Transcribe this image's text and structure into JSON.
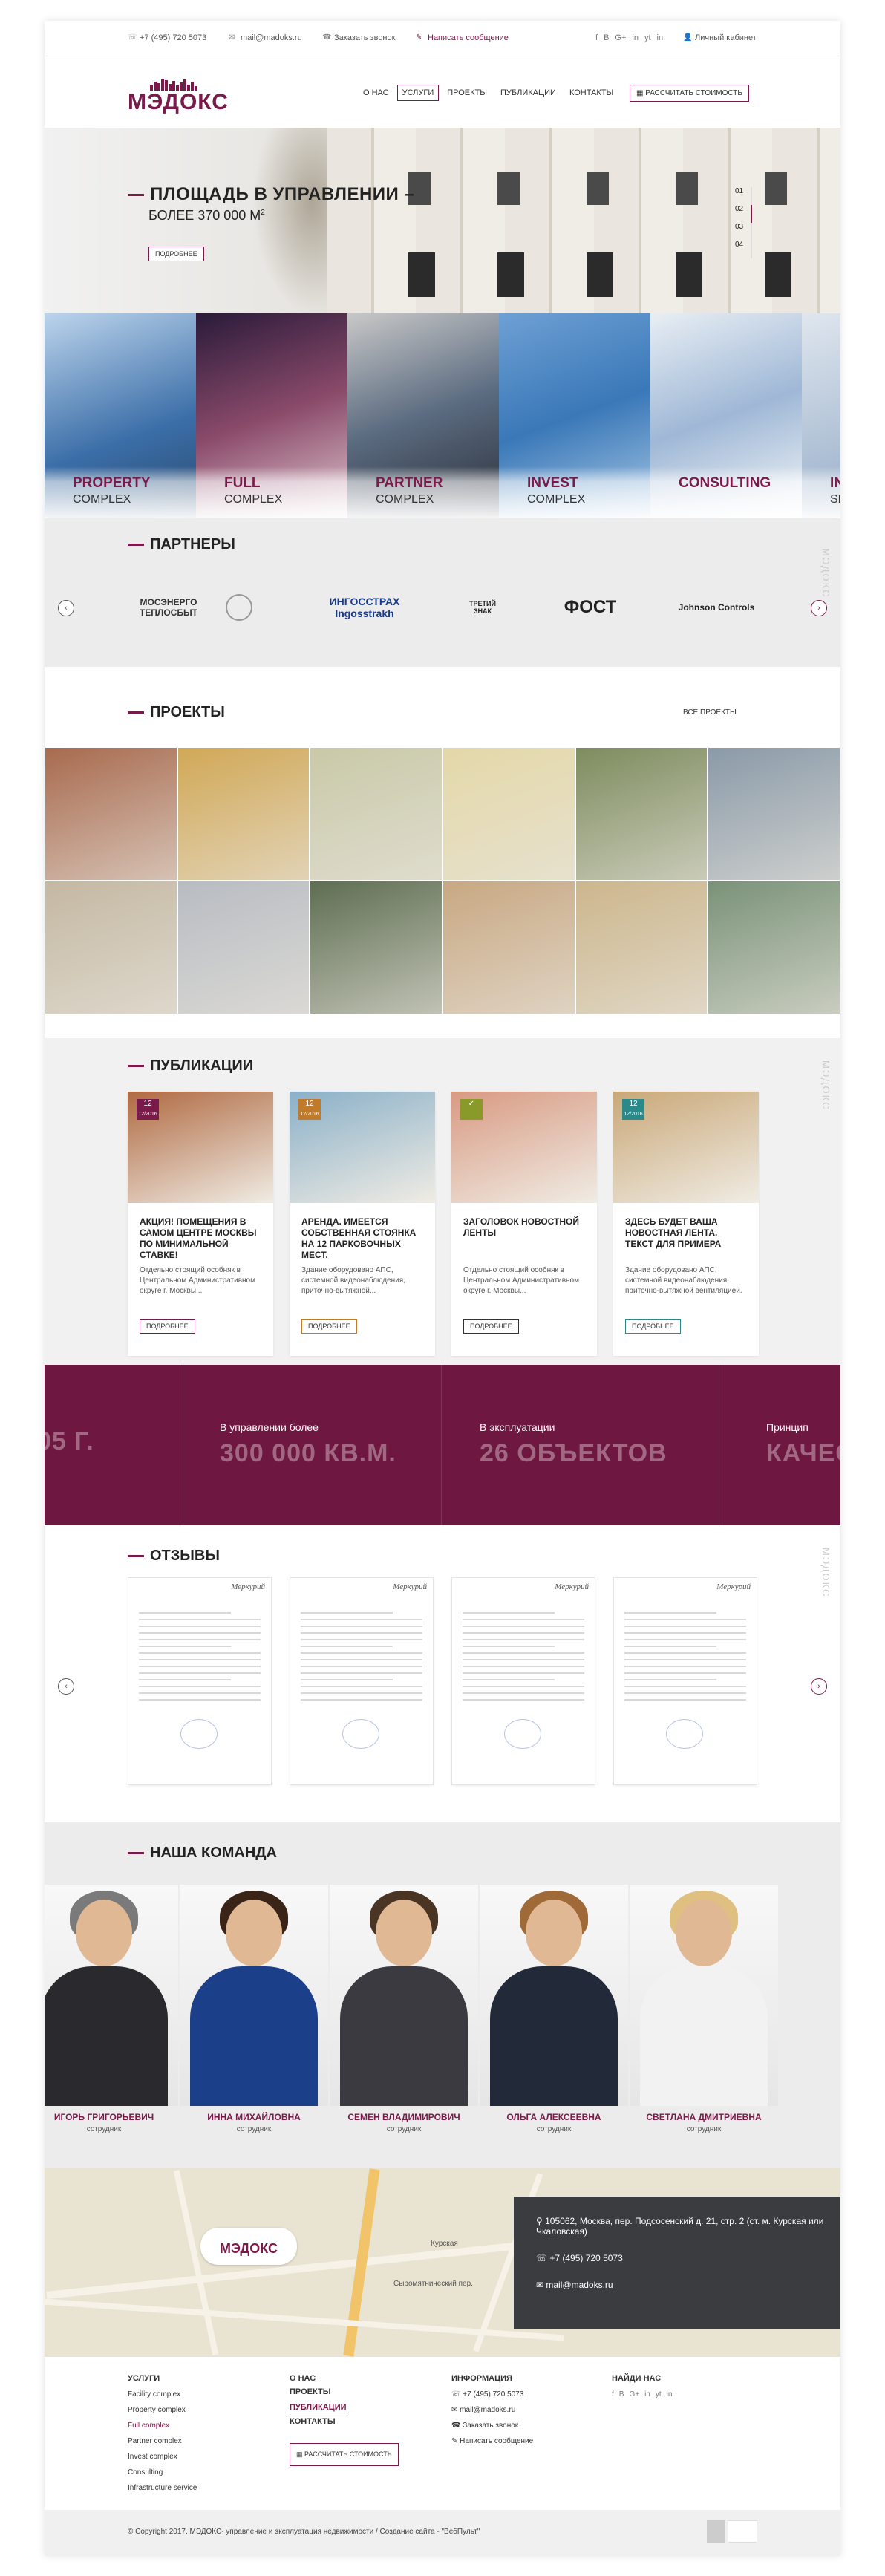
{
  "topbar": {
    "phone": "+7 (495) 720 5073",
    "email": "mail@madoks.ru",
    "callback": "Заказать звонок",
    "write": "Написать сообщение",
    "cabinet": "Личный кабинет",
    "socials": [
      "f",
      "B",
      "G+",
      "in",
      "yt",
      "in"
    ]
  },
  "header": {
    "logo": "МЭДОКС",
    "menu": [
      "О НАС",
      "УСЛУГИ",
      "ПРОЕКТЫ",
      "ПУБЛИКАЦИИ",
      "КОНТАКТЫ"
    ],
    "active_menu": "УСЛУГИ",
    "calc_button": "РАССЧИТАТЬ СТОИМОСТЬ"
  },
  "hero": {
    "title": "ПЛОЩАДЬ В УПРАВЛЕНИИ –",
    "subtitle": "БОЛЕЕ 370 000 м",
    "subtitle_sup": "2",
    "button": "ПОДРОБНЕЕ",
    "slides": [
      "01",
      "02",
      "03",
      "04"
    ],
    "active_slide": "02"
  },
  "categories": [
    {
      "title": "PROPERTY",
      "sub": "COMPLEX",
      "bg": "#4a7fb5"
    },
    {
      "title": "FULL",
      "sub": "COMPLEX",
      "bg": "#8a4a6a"
    },
    {
      "title": "PARTNER",
      "sub": "COMPLEX",
      "bg": "#5b6b80"
    },
    {
      "title": "INVEST",
      "sub": "COMPLEX",
      "bg": "#4d8ac4"
    },
    {
      "title": "CONSULTING",
      "sub": "",
      "bg": "#9fb8d6"
    },
    {
      "title": "IN",
      "sub": "SE",
      "bg": "#8aa4c2"
    }
  ],
  "partners": {
    "title": "ПАРТНЕРЫ",
    "logos": [
      "МОСЭНЕРГО ТЕПЛОСБЫТ",
      "ИНГОССТРАХ Ingosstrakh",
      "ТРЕТИЙ ЗНАК",
      "ФОСТ",
      "Johnson Controls"
    ],
    "watermark": "МЭДОКС"
  },
  "projects": {
    "title": "ПРОЕКТЫ",
    "all": "ВСЕ ПРОЕКТЫ",
    "tiles": [
      "#a86a4e",
      "#d1a856",
      "#c9c9a8",
      "#e4d8a8",
      "#7d8c5e",
      "#8a9aa8",
      "#c4b8a2",
      "#b8bcc2",
      "#5e6e52",
      "#c8a882",
      "#ccb68c",
      "#7a9278"
    ]
  },
  "publications": {
    "title": "ПУБЛИКАЦИИ",
    "items": [
      {
        "badge": "12",
        "date": "12/2016",
        "badge_color": "#7a1a4a",
        "title": "АКЦИЯ! ПОМЕЩЕНИЯ В САМОМ ЦЕНТРЕ МОСКВЫ ПО МИНИМАЛЬНОЙ СТАВКЕ!",
        "desc": "Отдельно стоящий особняк в Центральном Административном округе г. Москвы...",
        "button": "ПОДРОБНЕЕ",
        "img": "#b06a42",
        "btn_color": "#7a1a4a"
      },
      {
        "badge": "12",
        "date": "12/2016",
        "badge_color": "#c07a2a",
        "title": "АРЕНДА. ИМЕЕТСЯ СОБСТВЕННАЯ СТОЯНКА НА 12 ПАРКОВОЧНЫХ МЕСТ.",
        "desc": "Здание оборудовано АПС, системной видеонаблюдения, приточно-вытяжной...",
        "button": "ПОДРОБНЕЕ",
        "img": "#8ab0c8",
        "btn_color": "#c07a2a"
      },
      {
        "badge": "✓",
        "date": "",
        "badge_color": "#8a9a2a",
        "title": "ЗАГОЛОВОК НОВОСТНОЙ ЛЕНТЫ",
        "desc": "Отдельно стоящий особняк в Центральном Административном округе г. Москвы...",
        "button": "ПОДРОБНЕЕ",
        "img": "#d89a82",
        "btn_color": "#333333"
      },
      {
        "badge": "12",
        "date": "12/2016",
        "badge_color": "#2a8a8a",
        "title": "ЗДЕСЬ БУДЕТ ВАША НОВОСТНАЯ ЛЕНТА. ТЕКСТ ДЛЯ ПРИМЕРА",
        "desc": "Здание оборудовано АПС, системной видеонаблюдения, приточно-вытяжной вентиляцией.",
        "button": "ПОДРОБНЕЕ",
        "img": "#c9a878",
        "btn_color": "#2a8a8a"
      }
    ]
  },
  "stats": [
    {
      "label": "",
      "value": "05 г."
    },
    {
      "label": "В управлении более",
      "value": "300 000 кв.м."
    },
    {
      "label": "В эксплуатации",
      "value": "26 ОБЪЕКТОВ"
    },
    {
      "label": "Принцип",
      "value": "КАЧЕС"
    }
  ],
  "reviews": {
    "title": "ОТЗЫВЫ",
    "letterhead": "Меркурий",
    "count": 4
  },
  "team": {
    "title": "НАША КОМАНДА",
    "people": [
      {
        "name": "ИГОРЬ ГРИГОРЬЕВИЧ",
        "role": "сотрудник",
        "hair": "#7a7a7a",
        "suit": "#2a2a2e"
      },
      {
        "name": "ИННА МИХАЙЛОВНА",
        "role": "сотрудник",
        "hair": "#3a2418",
        "suit": "#1c3f8a"
      },
      {
        "name": "СЕМЕН ВЛАДИМИРОВИЧ",
        "role": "сотрудник",
        "hair": "#4a3424",
        "suit": "#3a3a40"
      },
      {
        "name": "ОЛЬГА АЛЕКСЕЕВНА",
        "role": "сотрудник",
        "hair": "#a06a38",
        "suit": "#222a3a"
      },
      {
        "name": "СВЕТЛАНА ДМИТРИЕВНА",
        "role": "сотрудник",
        "hair": "#e0c080",
        "suit": "#f2f2f2"
      }
    ]
  },
  "map": {
    "logo": "МЭДОКС",
    "address": "105062, Москва, пер. Подсосенский д. 21, стр. 2 (ст. м. Курская или Чкаловская)",
    "phone": "+7 (495) 720 5073",
    "email": "mail@madoks.ru",
    "labels": [
      "Курская",
      "Сыромятнический пер."
    ]
  },
  "footer": {
    "services_title": "УСЛУГИ",
    "services": [
      "Facility complex",
      "Property complex",
      "Full complex",
      "Partner complex",
      "Invest complex",
      "Consulting",
      "Infrastructure service"
    ],
    "about": [
      "О НАС",
      "ПРОЕКТЫ",
      "ПУБЛИКАЦИИ",
      "КОНТАКТЫ"
    ],
    "calc_button": "РАССЧИТАТЬ СТОИМОСТЬ",
    "info_title": "ИНФОРМАЦИЯ",
    "info": [
      "+7 (495) 720 5073",
      "mail@madoks.ru",
      "Заказать звонок",
      "Написать сообщение"
    ],
    "find_title": "НАЙДИ НАС",
    "copyright": "© Copyright 2017. МЭДОКС- управление и эксплуатация недвижимости  /  Создание сайта - \"ВебПульт\""
  }
}
